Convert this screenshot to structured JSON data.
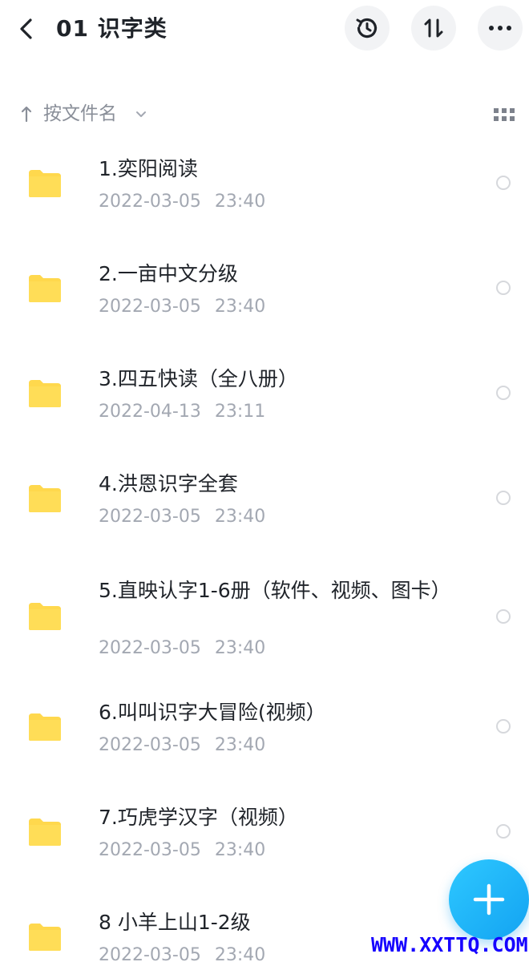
{
  "header": {
    "title": "01  识字类",
    "back_icon": "chevron-left-icon",
    "history_icon": "history-clock-icon",
    "sort_icon": "sort-up-down-icon",
    "more_icon": "more-horizontal-icon"
  },
  "sortbar": {
    "label": "按文件名",
    "arrow_icon": "arrow-up-icon",
    "chevron_icon": "chevron-down-icon",
    "view_icon": "grid-view-icon"
  },
  "files": [
    {
      "name": "1.奕阳阅读",
      "date": "2022-03-05 23:40"
    },
    {
      "name": "2.一亩中文分级",
      "date": "2022-03-05 23:40"
    },
    {
      "name": "3.四五快读（全八册）",
      "date": "2022-04-13 23:11"
    },
    {
      "name": "4.洪恩识字全套",
      "date": "2022-03-05 23:40"
    },
    {
      "name": "5.直映认字1-6册（软件、视频、图卡）",
      "date": "2022-03-05 23:40"
    },
    {
      "name": "6.叫叫识字大冒险(视频）",
      "date": "2022-03-05 23:40"
    },
    {
      "name": "7.巧虎学汉字（视频）",
      "date": "2022-03-05 23:40"
    },
    {
      "name": "8  小羊上山1-2级",
      "date": "2022-03-05 23:40"
    }
  ],
  "fab": {
    "icon": "plus-icon"
  },
  "watermark": "WWW.XXTTQ.COM",
  "colors": {
    "folder": "#ffd84d",
    "fab": "#1fb5f7",
    "secondary_text": "#a3a8b2",
    "watermark": "#1500ff"
  }
}
